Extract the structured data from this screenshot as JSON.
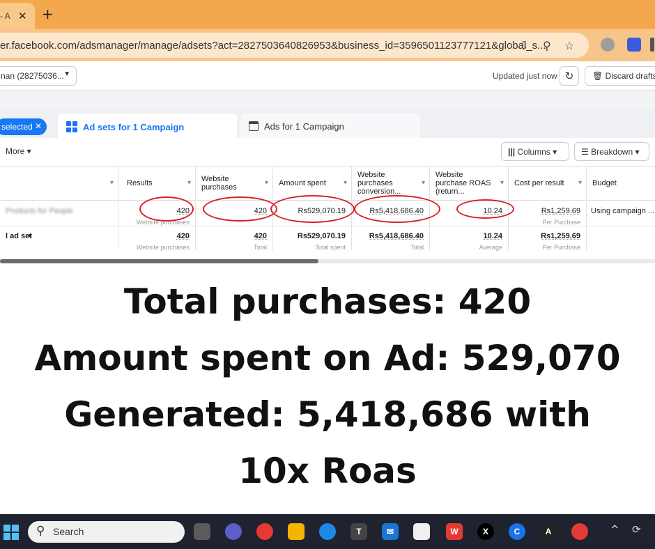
{
  "browser": {
    "tab_title": "- A",
    "tab_close": "✕",
    "new_tab": "+",
    "url": "er.facebook.com/adsmanager/manage/adsets?act=2827503640826953&business_id=3596501123777121&global_s..."
  },
  "header": {
    "account_label": "nan (28275036...",
    "updated_text": "Updated just now",
    "discard_label": "Discard drafts"
  },
  "tabs": {
    "selected_pill": "selected",
    "adsets_tab": "Ad sets for 1 Campaign",
    "ads_tab": "Ads for 1 Campaign"
  },
  "actions": {
    "more_label": "More",
    "columns_label": "Columns",
    "breakdown_label": "Breakdown"
  },
  "table": {
    "columns": [
      {
        "label": "Results"
      },
      {
        "label": "Website purchases"
      },
      {
        "label": "Amount spent"
      },
      {
        "label": "Website purchases conversion..."
      },
      {
        "label": "Website purchase ROAS (return..."
      },
      {
        "label": "Cost per result"
      },
      {
        "label": "Budget"
      }
    ],
    "row1": {
      "name": "Products for People",
      "results": "420",
      "results_sub": "Website purchases",
      "purchases": "420",
      "spent": "Rs529,070.19",
      "conv_value": "Rs5,418,686.40",
      "roas": "10.24",
      "cpr": "Rs1,259.69",
      "cpr_sub": "Per Purchase",
      "budget": "Using campaign ..."
    },
    "row2": {
      "name": "l ad set",
      "results": "420",
      "results_sub": "Website purchases",
      "purchases": "420",
      "purchases_sub": "Total",
      "spent": "Rs529,070.19",
      "spent_sub": "Total spent",
      "conv_value": "Rs5,418,686.40",
      "conv_sub": "Total",
      "roas": "10.24",
      "roas_sub": "Average",
      "cpr": "Rs1,259.69",
      "cpr_sub": "Per Purchase"
    }
  },
  "caption": {
    "line1": "Total purchases: 420",
    "line2": "Amount spent on Ad: 529,070",
    "line3": "Generated: 5,418,686 with",
    "line4": "10x Roas"
  },
  "taskbar": {
    "search_placeholder": "Search"
  },
  "colors": {
    "accent": "#1877f2",
    "highlight_circle": "#d81f26",
    "tab_strip": "#f4a84e"
  }
}
